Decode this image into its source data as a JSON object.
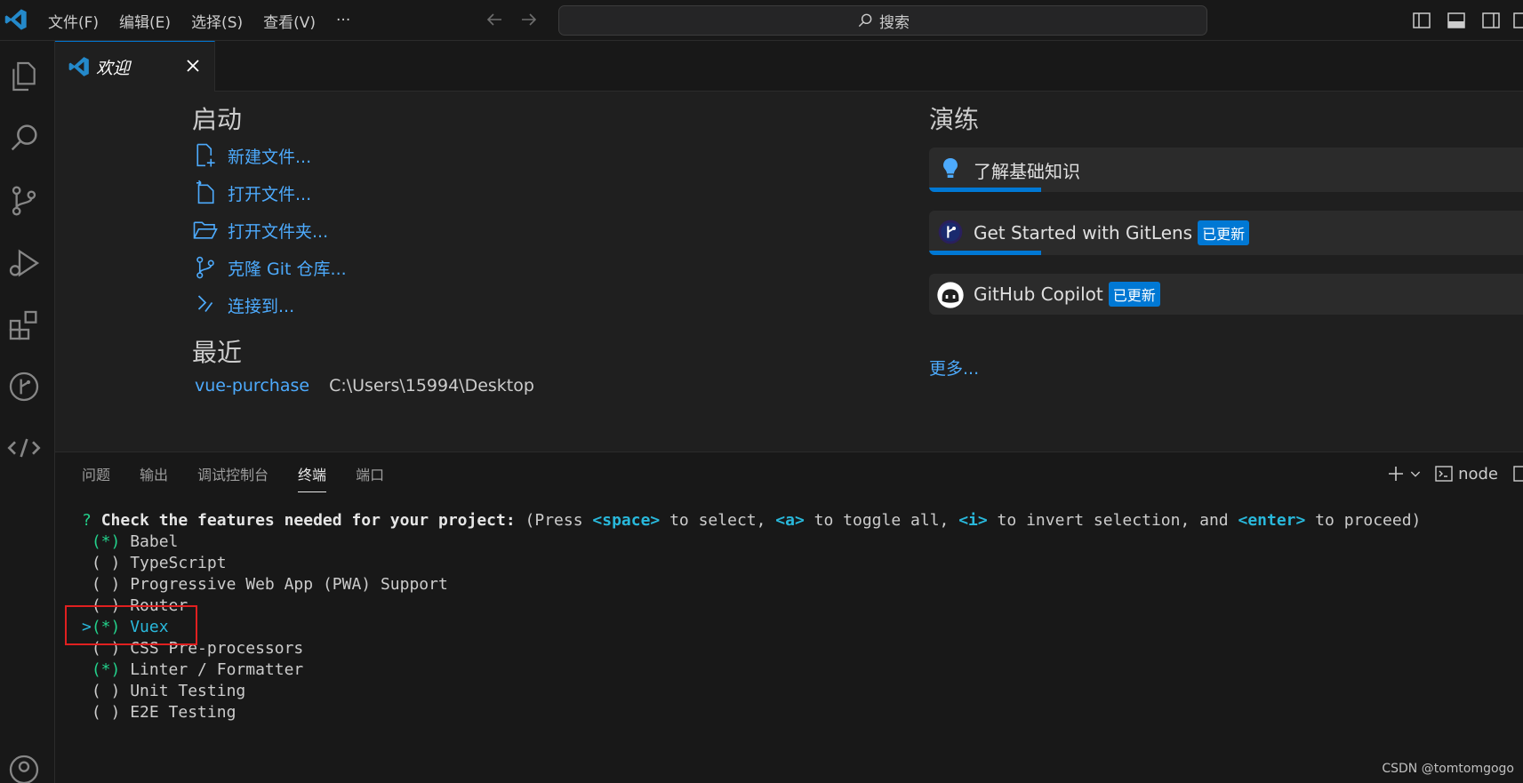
{
  "titlebar": {
    "menus": [
      "文件(F)",
      "编辑(E)",
      "选择(S)",
      "查看(V)",
      "···"
    ],
    "search_label": "搜索"
  },
  "activity_icons": [
    "explorer-icon",
    "search-icon",
    "source-control-icon",
    "run-debug-icon",
    "extensions-icon",
    "gitlens-icon",
    "remote-explorer-icon",
    "accounts-icon"
  ],
  "tab": {
    "label": "欢迎"
  },
  "welcome": {
    "start_title": "启动",
    "start_items": [
      "新建文件...",
      "打开文件...",
      "打开文件夹...",
      "克隆 Git 仓库...",
      "连接到..."
    ],
    "recent_title": "最近",
    "recent": [
      {
        "name": "vue-purchase",
        "path": "C:\\Users\\15994\\Desktop"
      }
    ],
    "walkthrough_title": "演练",
    "walkthroughs": [
      {
        "title": "了解基础知识",
        "badge": "",
        "progress": 0.18
      },
      {
        "title": "Get Started with GitLens",
        "badge": "已更新",
        "progress": 0.18
      },
      {
        "title": "GitHub Copilot",
        "badge": "已更新",
        "progress": 0
      }
    ],
    "more_label": "更多..."
  },
  "panel": {
    "tabs": [
      "问题",
      "输出",
      "调试控制台",
      "终端",
      "端口"
    ],
    "active_tab": "终端",
    "terminal_profile": "node"
  },
  "terminal": {
    "prompt_mark": "?",
    "prompt_question": "Check the features needed for your project:",
    "prompt_hint_1": "(Press ",
    "key_space": "<space>",
    "prompt_hint_2": " to select, ",
    "key_a": "<a>",
    "prompt_hint_3": " to toggle all, ",
    "key_i": "<i>",
    "prompt_hint_4": " to invert selection, and ",
    "key_enter": "<enter>",
    "prompt_hint_5": " to proceed)",
    "options": [
      {
        "mark": "(*)",
        "label": "Babel",
        "checked": true,
        "cursor": false
      },
      {
        "mark": "( )",
        "label": "TypeScript",
        "checked": false,
        "cursor": false
      },
      {
        "mark": "( )",
        "label": "Progressive Web App (PWA) Support",
        "checked": false,
        "cursor": false
      },
      {
        "mark": "( )",
        "label": "Router",
        "checked": false,
        "cursor": false
      },
      {
        "mark": "(*)",
        "label": "Vuex",
        "checked": true,
        "cursor": true
      },
      {
        "mark": "( )",
        "label": "CSS Pre-processors",
        "checked": false,
        "cursor": false
      },
      {
        "mark": "(*)",
        "label": "Linter / Formatter",
        "checked": true,
        "cursor": false
      },
      {
        "mark": "( )",
        "label": "Unit Testing",
        "checked": false,
        "cursor": false
      },
      {
        "mark": "( )",
        "label": "E2E Testing",
        "checked": false,
        "cursor": false
      }
    ],
    "cursor_mark": ">"
  },
  "watermark": "CSDN @tomtomgogo",
  "colors": {
    "accent": "#0078d4",
    "link": "#4daafc",
    "terminal_green": "#23d18b",
    "terminal_cyan": "#29b8db",
    "highlight_box": "#e02020"
  }
}
